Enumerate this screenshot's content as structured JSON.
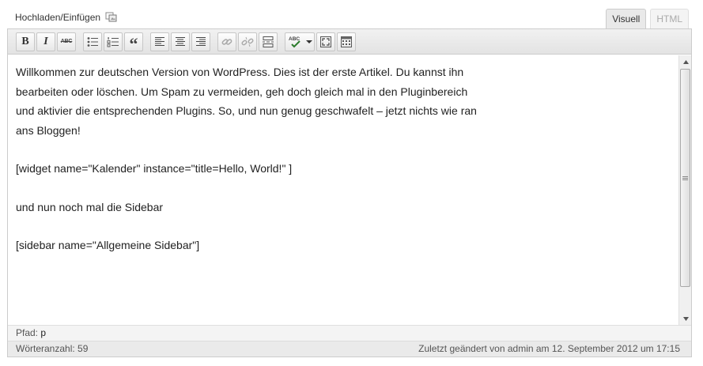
{
  "media": {
    "label": "Hochladen/Einfügen",
    "icon": "add-media-icon"
  },
  "tabs": [
    {
      "label": "Visuell",
      "active": true
    },
    {
      "label": "HTML",
      "active": false
    }
  ],
  "toolbar": {
    "buttons": [
      {
        "icon": "bold-icon",
        "glyph": "B"
      },
      {
        "icon": "italic-icon",
        "glyph": "I"
      },
      {
        "icon": "strikethrough-icon",
        "glyph": "ABC"
      },
      {
        "icon": "bullet-list-icon"
      },
      {
        "icon": "numbered-list-icon"
      },
      {
        "icon": "blockquote-icon",
        "glyph": "“"
      },
      {
        "icon": "align-left-icon"
      },
      {
        "icon": "align-center-icon"
      },
      {
        "icon": "align-right-icon"
      },
      {
        "icon": "insert-link-icon"
      },
      {
        "icon": "remove-link-icon"
      },
      {
        "icon": "insert-more-icon"
      },
      {
        "icon": "spellcheck-icon",
        "glyph": "ABC"
      },
      {
        "icon": "fullscreen-icon"
      },
      {
        "icon": "kitchen-sink-icon"
      }
    ]
  },
  "content": {
    "paragraphs": [
      "Willkommen zur deutschen Version von WordPress. Dies ist der erste Artikel. Du kannst ihn bearbeiten oder löschen. Um Spam zu vermeiden, geh doch gleich mal in den Pluginbereich und aktivier die entsprechenden Plugins. So, und nun genug geschwafelt – jetzt nichts wie ran ans Bloggen!",
      "[widget name=\"Kalender\" instance=\"title=Hello, World!\" ]",
      "und nun noch mal die Sidebar",
      "[sidebar name=\"Allgemeine Sidebar\"]"
    ]
  },
  "path": {
    "label": "Pfad:",
    "element": "p"
  },
  "status": {
    "word_count": "Wörteranzahl: 59",
    "last_modified": "Zuletzt geändert von admin am 12. September 2012 um 17:15"
  },
  "colors": {
    "toolbar_bg": "#e8e8e8",
    "tab_active_bg": "#e9e9e9",
    "inactive_tab_text": "#aaaaaa"
  }
}
